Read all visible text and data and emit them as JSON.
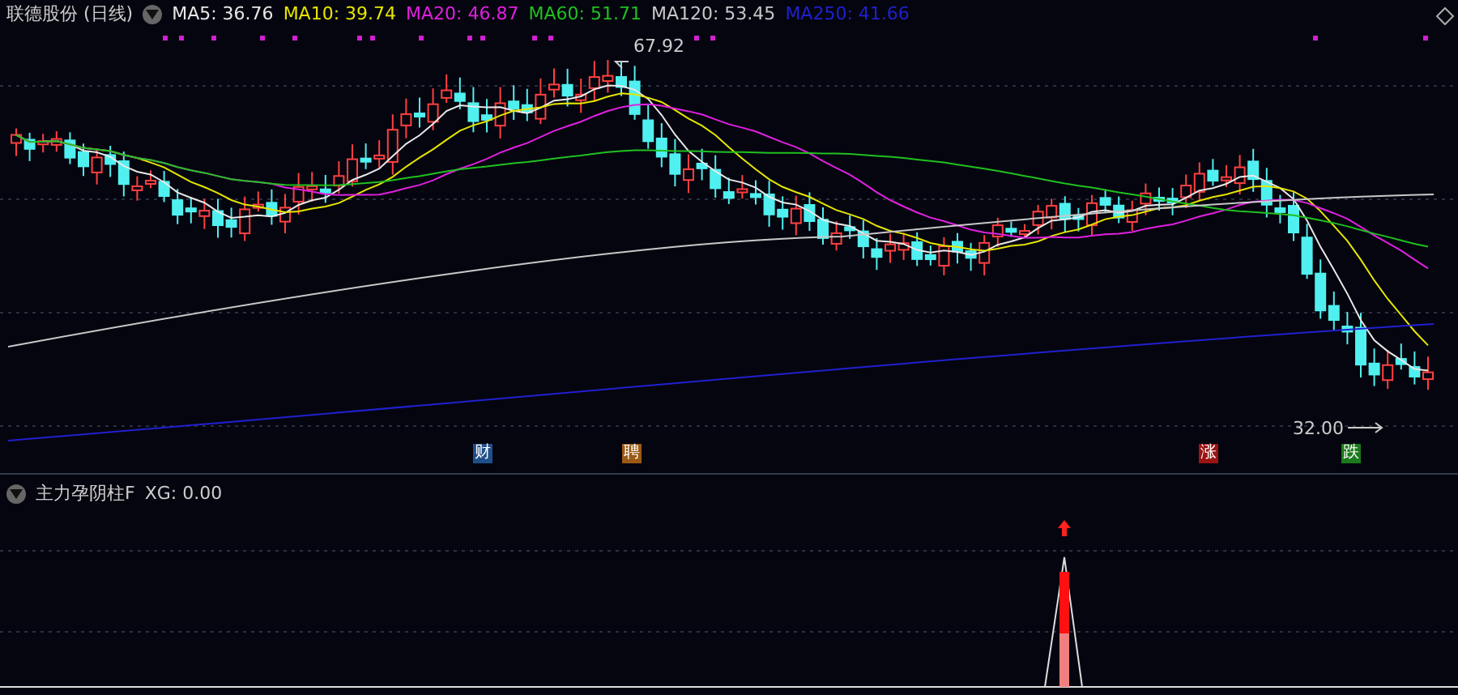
{
  "chart_header": {
    "title": "联德股份 (日线)",
    "ma_legend": [
      {
        "label": "MA5: 36.76",
        "color": "#e8e8e8"
      },
      {
        "label": "MA10: 39.74",
        "color": "#e6e600"
      },
      {
        "label": "MA20: 46.87",
        "color": "#e020e0"
      },
      {
        "label": "MA60: 51.71",
        "color": "#20c020"
      },
      {
        "label": "MA120: 53.45",
        "color": "#c8c8c8"
      },
      {
        "label": "MA250: 41.66",
        "color": "#2020d0"
      }
    ]
  },
  "price_labels": {
    "high": "67.92",
    "low": "32.00"
  },
  "event_markers": [
    {
      "label": "财",
      "color": "#1f4f8a"
    },
    {
      "label": "聘",
      "color": "#9a5a16"
    },
    {
      "label": "涨",
      "color": "#9a1414"
    },
    {
      "label": "跌",
      "color": "#1c7a1c"
    }
  ],
  "indicator": {
    "title": "主力孕阴柱F",
    "value": "XG: 0.00"
  }
}
